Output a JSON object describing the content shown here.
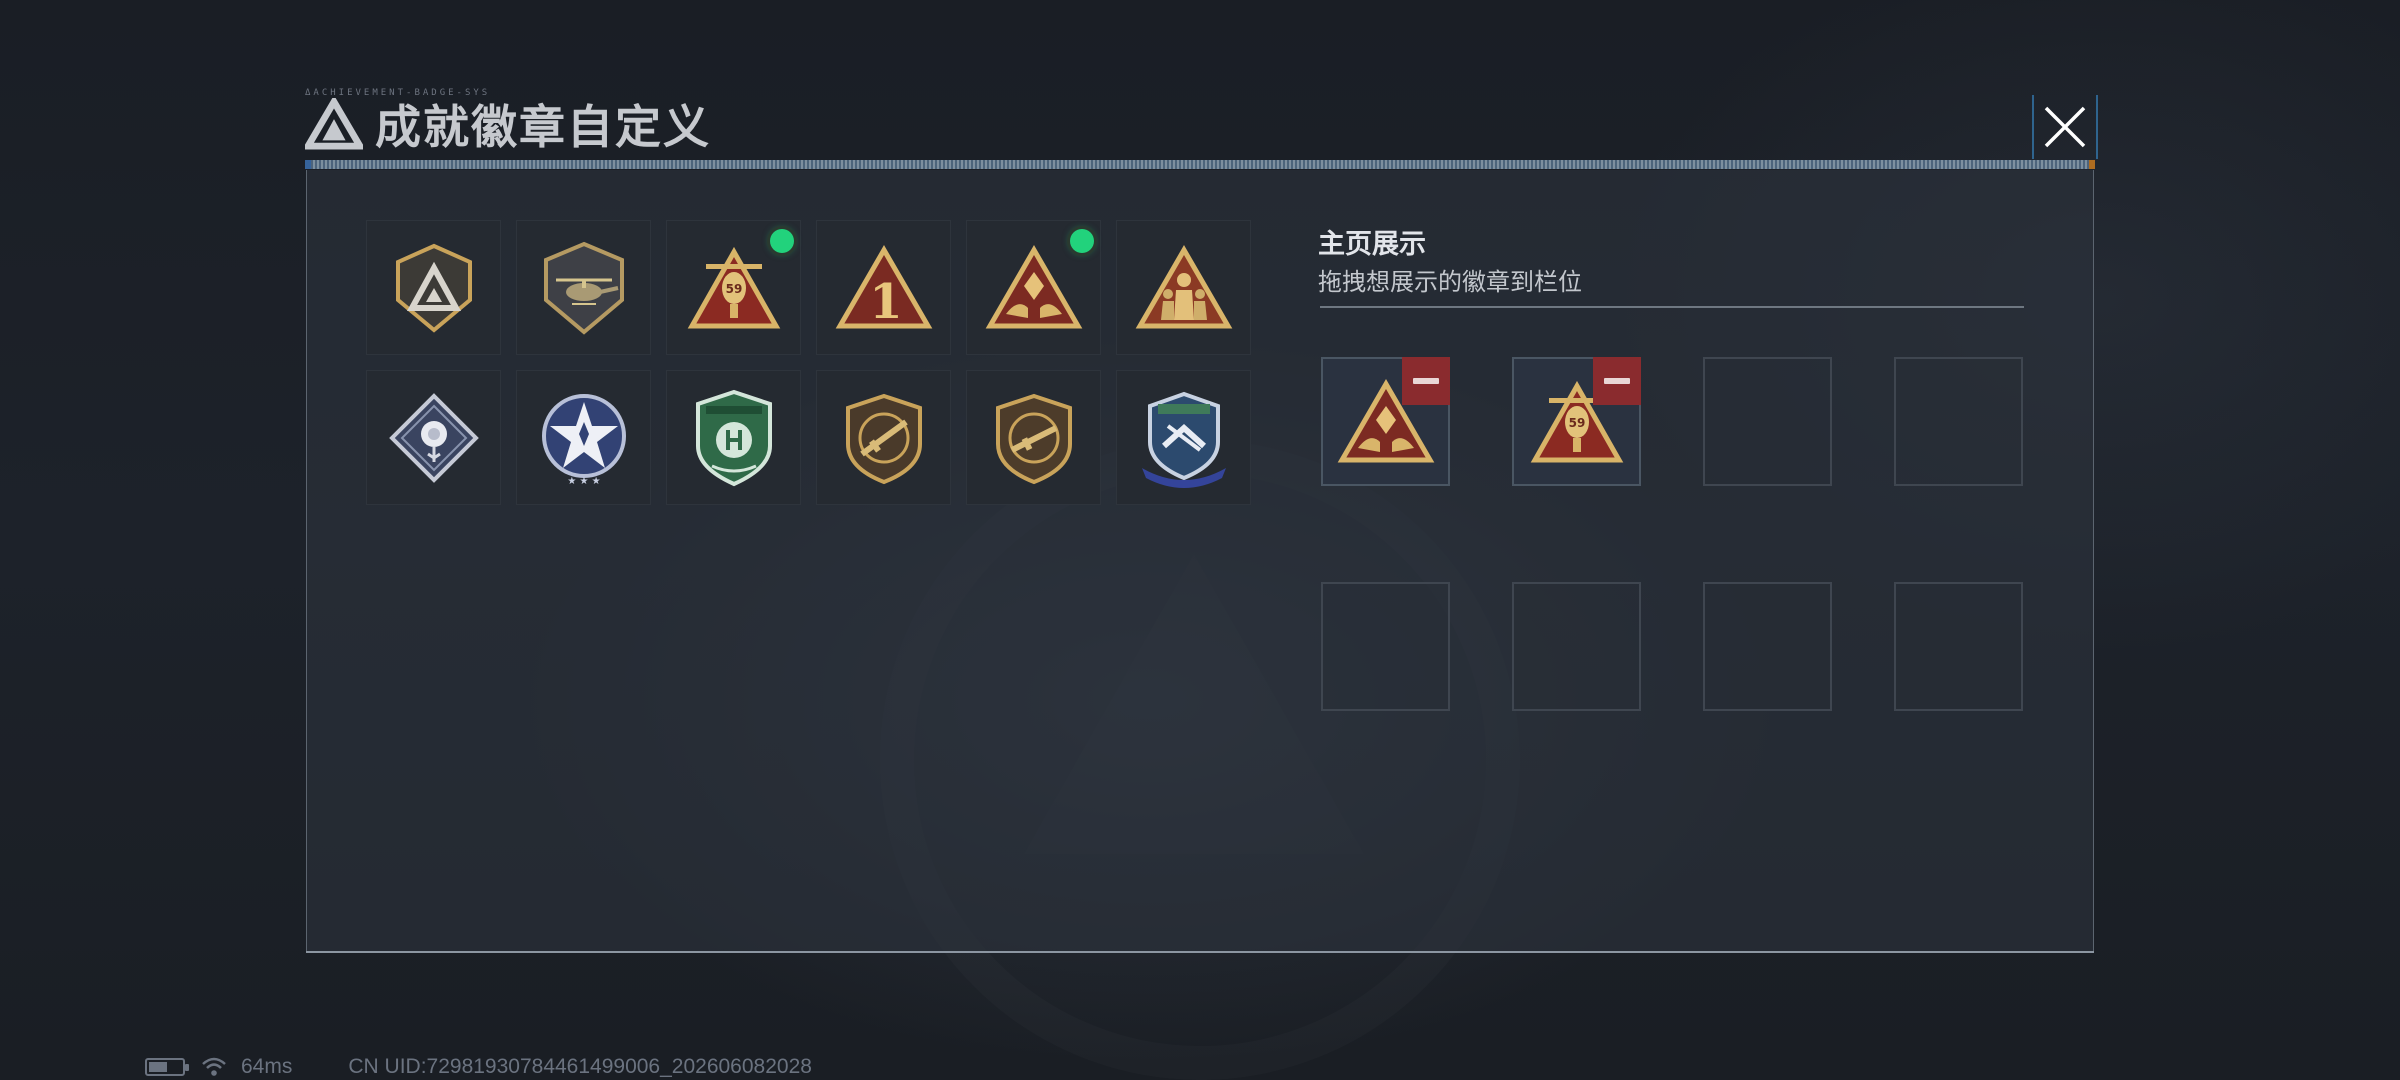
{
  "header": {
    "title": "成就徽章自定义",
    "deco_text": "ΔACHIEVEMENT-BADGE-SYS",
    "close_label": "close"
  },
  "badge_collection": [
    {
      "icon": "delta-shield-badge-icon",
      "new": false
    },
    {
      "icon": "helicopter-shield-badge-icon",
      "new": false
    },
    {
      "icon": "helicopter-59-triangle-badge-icon",
      "new": true
    },
    {
      "icon": "number-one-triangle-badge-icon",
      "new": false
    },
    {
      "icon": "hands-crystal-triangle-badge-icon",
      "new": true
    },
    {
      "icon": "soldiers-triangle-badge-icon",
      "new": false
    },
    {
      "icon": "rose-diamond-badge-icon",
      "new": false
    },
    {
      "icon": "star-wreath-badge-icon",
      "new": false
    },
    {
      "icon": "green-shield-badge-icon",
      "new": false
    },
    {
      "icon": "rifle-shield-badge-icon",
      "new": false
    },
    {
      "icon": "rifle-shield-badge-icon-2",
      "new": false
    },
    {
      "icon": "blue-winged-shield-badge-icon",
      "new": false
    }
  ],
  "showcase": {
    "title": "主页展示",
    "subtitle": "拖拽想展示的徽章到栏位",
    "slots": [
      {
        "badge": "hands-crystal-triangle-badge-icon",
        "filled": true
      },
      {
        "badge": "helicopter-59-triangle-badge-icon",
        "filled": true
      },
      {
        "badge": "",
        "filled": false
      },
      {
        "badge": "",
        "filled": false
      },
      {
        "badge": "",
        "filled": false
      },
      {
        "badge": "",
        "filled": false
      },
      {
        "badge": "",
        "filled": false
      },
      {
        "badge": "",
        "filled": false
      }
    ]
  },
  "status": {
    "ping": "64ms",
    "uid": "CN UID:7298193078446149900​6_202606082028"
  },
  "colors": {
    "new_indicator": "#22d27c",
    "remove_button": "#8a2b2e",
    "gold": "#c9a35a"
  }
}
